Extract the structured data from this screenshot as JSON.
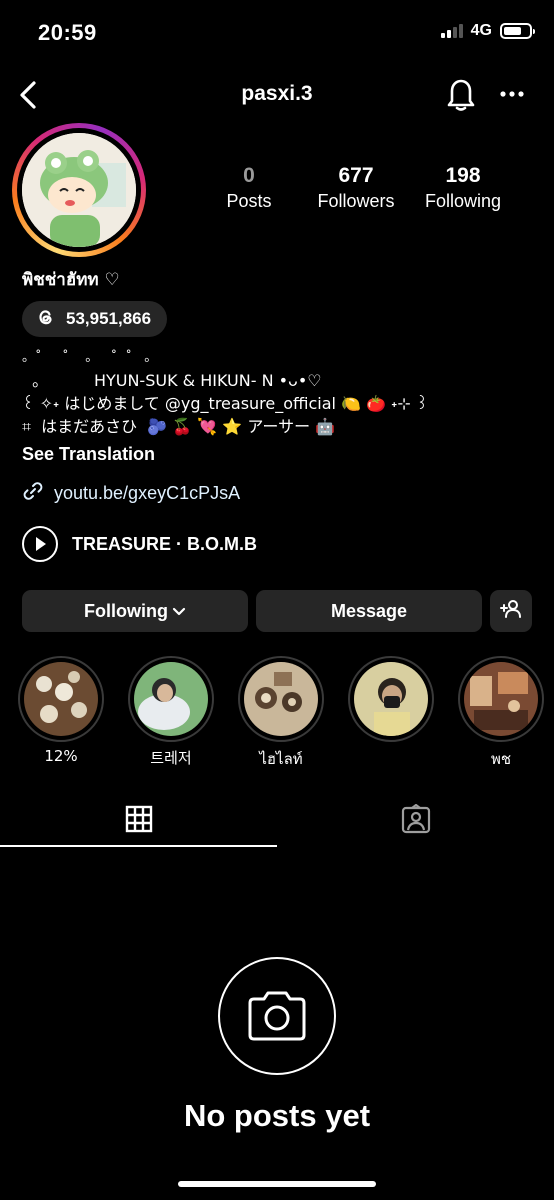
{
  "status_bar": {
    "time": "20:59",
    "network": "4G",
    "battery_level": 0.7
  },
  "nav": {
    "username": "pasxi.3",
    "back_icon": "chevron-left-icon",
    "bell_icon": "bell-icon",
    "more_icon": "more-horizontal-icon"
  },
  "profile": {
    "display_name": "พิชช่าฮัทท ♡",
    "threads_count": "53,951,866",
    "stats": [
      {
        "value": "0",
        "label": "Posts"
      },
      {
        "value": "677",
        "label": "Followers"
      },
      {
        "value": "198",
        "label": "Following"
      }
    ],
    "bio": [
      "˚   ˚     ˚      ˚",
      "  。         HYUN-SUK & HIKUN- N •ᴗ•♡",
      "꒰ ✧˖ はじめまして @yg_treasure_official 🍋 🍅 ˖⊹ ꒱",
      "⌗  はまだあさひ  🫐 🍒 💘 ⭐ アーサー 🤖"
    ],
    "bio_top": "。˚     ˚    。   ˚  ˚   。",
    "see_translation": "See Translation",
    "link": "youtu.be/gxeyC1cPJsA",
    "music": "TREASURE · B.O.M.B"
  },
  "actions": {
    "following": "Following",
    "message": "Message"
  },
  "highlights": [
    {
      "label": "12%"
    },
    {
      "label": "트레저"
    },
    {
      "label": "ไฮไลท์"
    },
    {
      "label": ""
    },
    {
      "label": "พช"
    }
  ],
  "tabs": {
    "grid_icon": "grid-icon",
    "tagged_icon": "tagged-person-icon"
  },
  "empty_state": {
    "icon": "camera-icon",
    "title": "No posts yet"
  },
  "colors": {
    "background": "#000000",
    "button_bg": "#262626",
    "link": "#e0f1ff",
    "zero_count": "#9a9a9a"
  }
}
